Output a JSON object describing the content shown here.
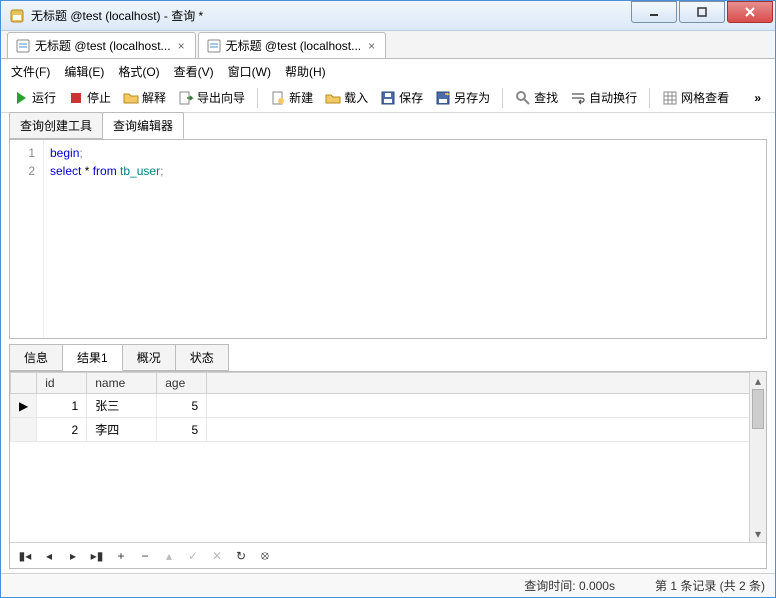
{
  "window": {
    "title": "无标题 @test (localhost) - 查询 *"
  },
  "doc_tabs": [
    {
      "label": "无标题 @test (localhost...",
      "active": true
    },
    {
      "label": "无标题 @test (localhost...",
      "active": false
    }
  ],
  "menu": {
    "file": "文件(F)",
    "edit": "编辑(E)",
    "format": "格式(O)",
    "view": "查看(V)",
    "window": "窗口(W)",
    "help": "帮助(H)"
  },
  "toolbar": {
    "run": "运行",
    "stop": "停止",
    "explain": "解释",
    "export_wizard": "导出向导",
    "new": "新建",
    "load": "载入",
    "save": "保存",
    "save_as": "另存为",
    "find": "查找",
    "auto_wrap": "自动换行",
    "grid_view": "网格查看"
  },
  "inner_tabs": {
    "builder": "查询创建工具",
    "editor": "查询编辑器"
  },
  "code": {
    "lines": [
      "1",
      "2"
    ],
    "text_tokens": [
      [
        {
          "t": "begin",
          "c": "kw"
        },
        {
          "t": ";",
          "c": "op"
        }
      ],
      [
        {
          "t": "select",
          "c": "kw"
        },
        {
          "t": " * ",
          "c": ""
        },
        {
          "t": "from",
          "c": "kw"
        },
        {
          "t": " ",
          "c": ""
        },
        {
          "t": "tb_user",
          "c": "id"
        },
        {
          "t": ";",
          "c": "op"
        }
      ]
    ]
  },
  "result_tabs": {
    "info": "信息",
    "result1": "结果1",
    "profile": "概况",
    "status": "状态"
  },
  "grid": {
    "columns": [
      "id",
      "name",
      "age"
    ],
    "rows": [
      {
        "id": "1",
        "name": "张三",
        "age": "5"
      },
      {
        "id": "2",
        "name": "李四",
        "age": "5"
      }
    ]
  },
  "statusbar": {
    "query_time": "查询时间: 0.000s",
    "record_info": "第 1 条记录 (共 2 条)"
  }
}
